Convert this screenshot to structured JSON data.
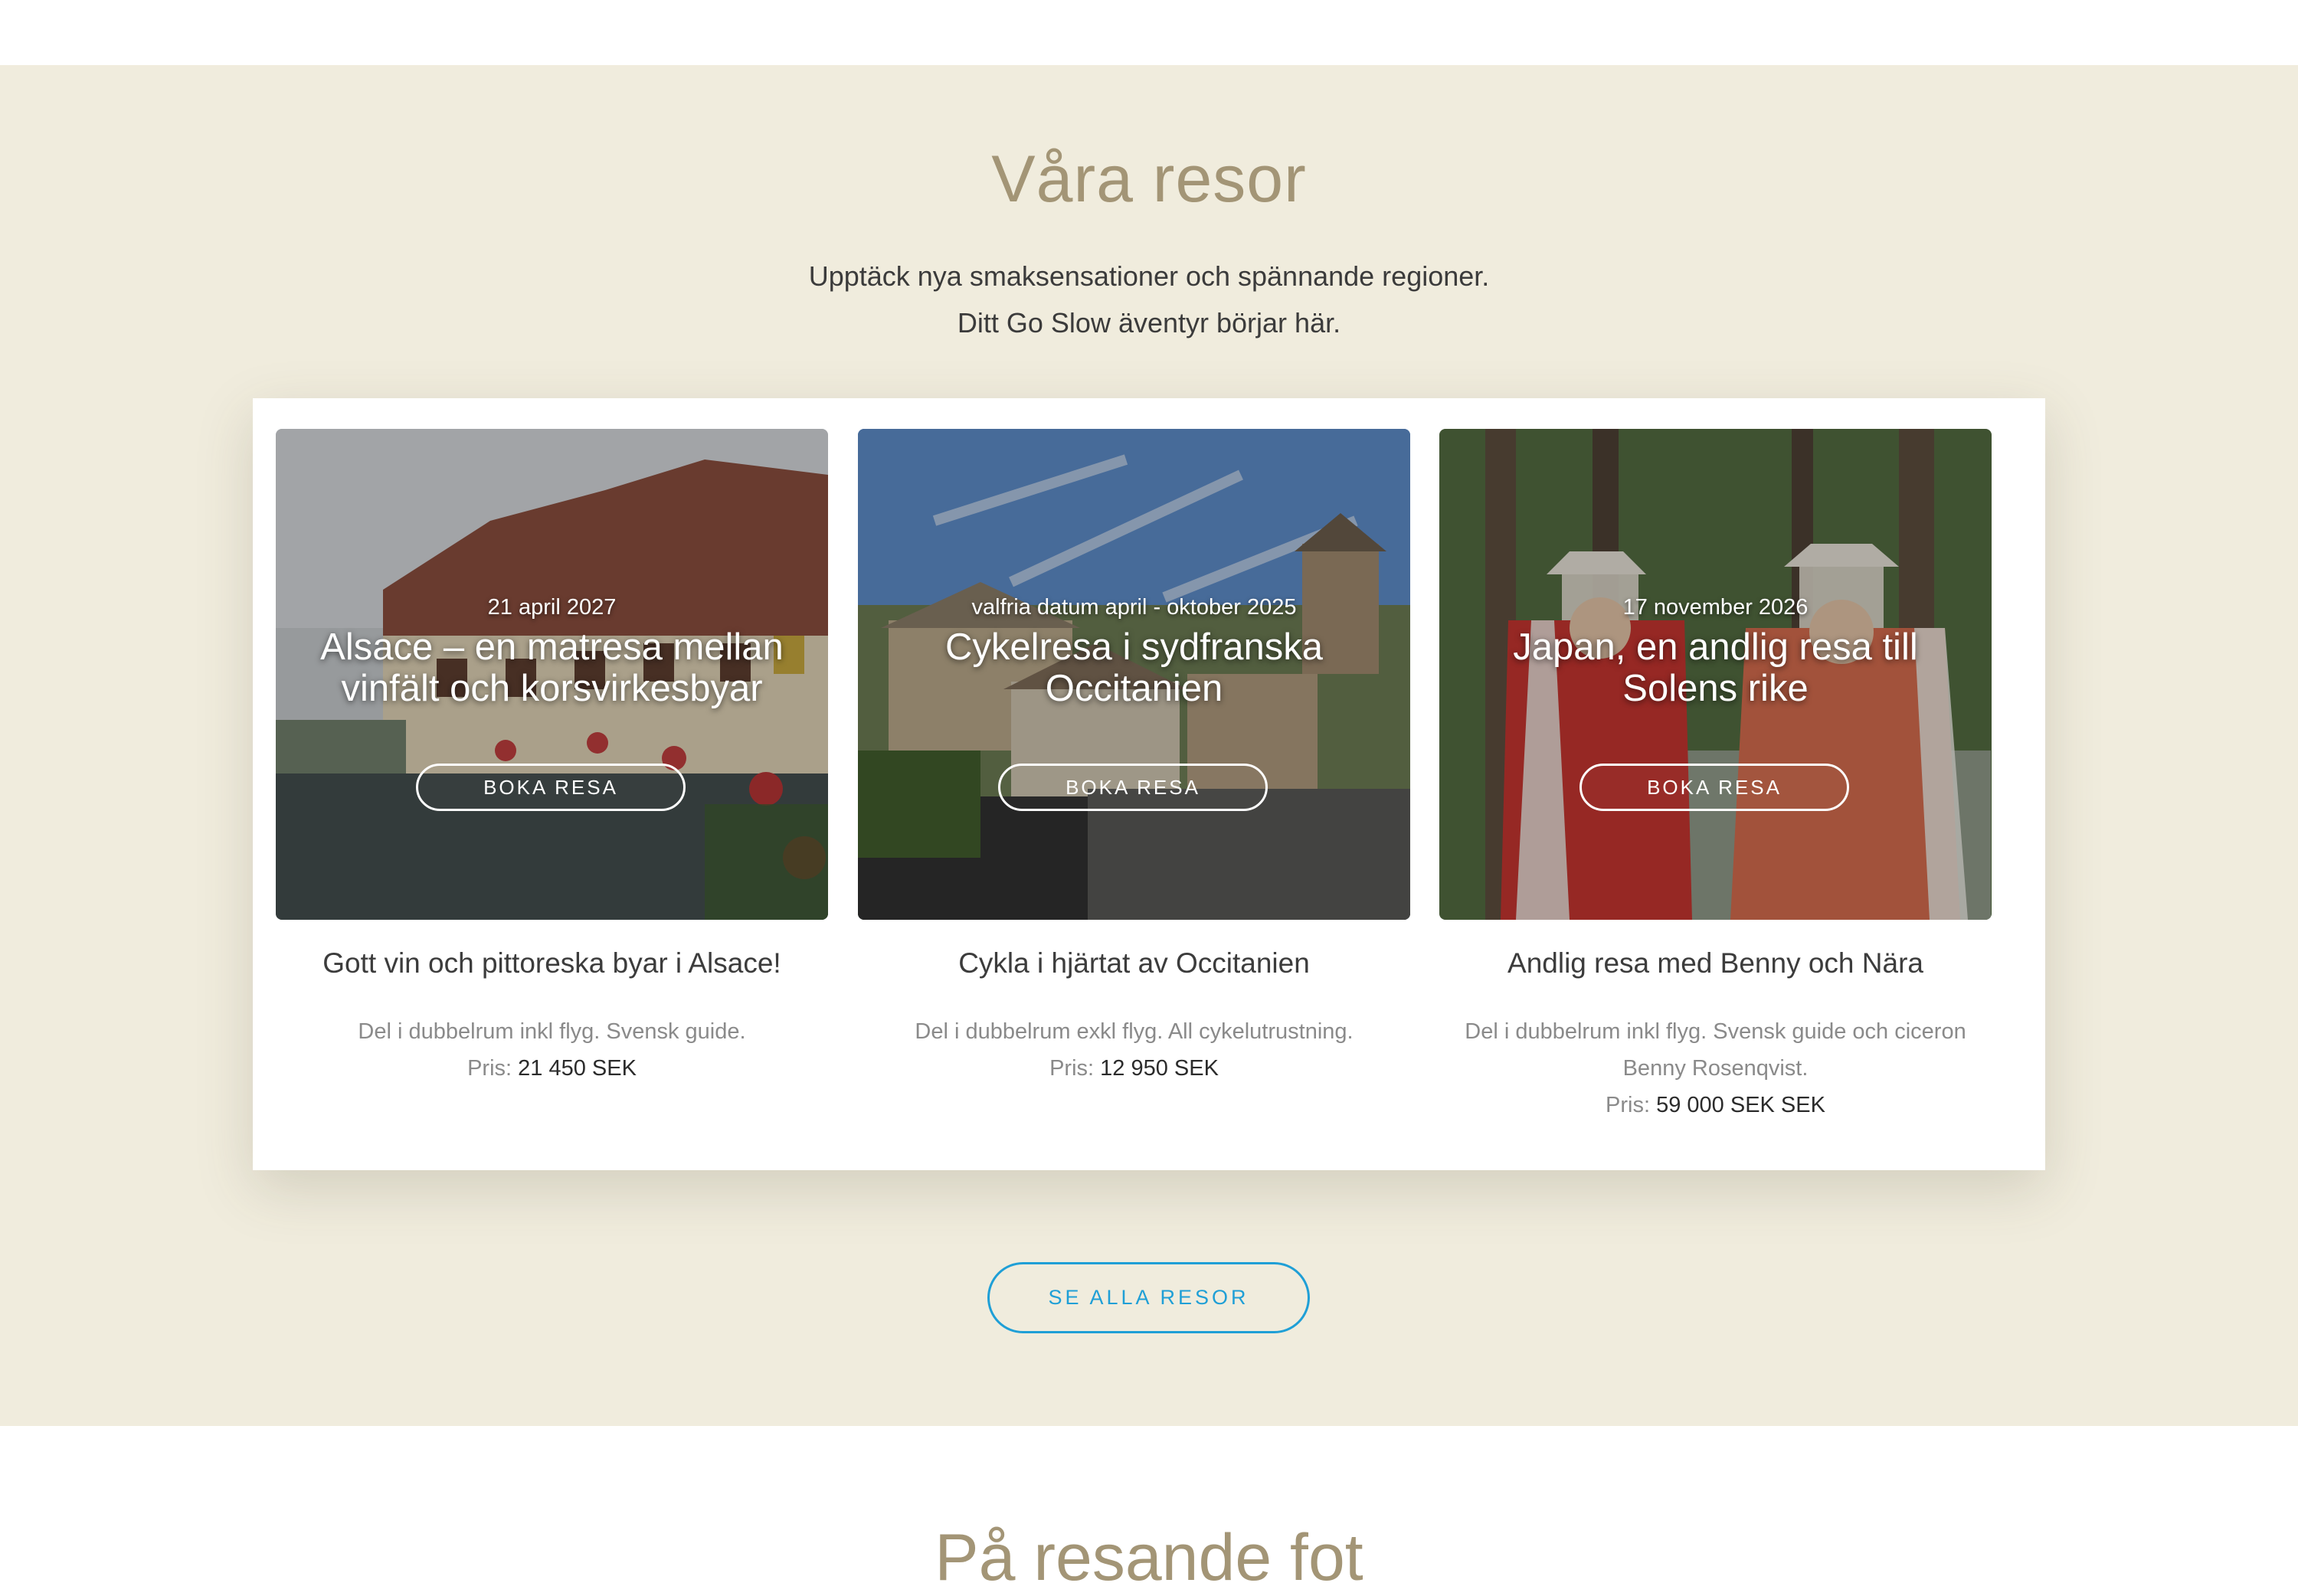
{
  "section": {
    "title": "Våra resor",
    "subtitle_line1": "Upptäck nya smaksensationer och spännande regioner.",
    "subtitle_line2": "Ditt Go Slow äventyr börjar här."
  },
  "cards": [
    {
      "date": "21 april 2027",
      "title": "Alsace – en matresa mellan vinfält och korsvirkesbyar",
      "button": "BOKA RESA",
      "heading": "Gott vin och pittoreska byar i Alsace!",
      "description": "Del i dubbelrum inkl flyg. Svensk guide.",
      "price_label": "Pris:",
      "price_value": "21 450 SEK"
    },
    {
      "date": "valfria datum april - oktober 2025",
      "title": "Cykelresa i sydfranska Occitanien",
      "button": "BOKA RESA",
      "heading": "Cykla i hjärtat av Occitanien",
      "description": "Del i dubbelrum exkl flyg. All cykelutrustning.",
      "price_label": "Pris:",
      "price_value": "12 950 SEK"
    },
    {
      "date": "17 november 2026",
      "title": "Japan, en andlig resa till Solens rike",
      "button": "BOKA RESA",
      "heading": "Andlig resa med Benny och Nära",
      "description": "Del i dubbelrum inkl flyg. Svensk guide och ciceron Benny Rosenqvist.",
      "price_label": "Pris:",
      "price_value": "59 000 SEK SEK"
    }
  ],
  "see_all": "SE ALLA RESOR",
  "next_section_title": "På resande fot",
  "colors": {
    "section_bg": "#f0ecdd",
    "title": "#a39576",
    "accent": "#1f9fd6"
  }
}
